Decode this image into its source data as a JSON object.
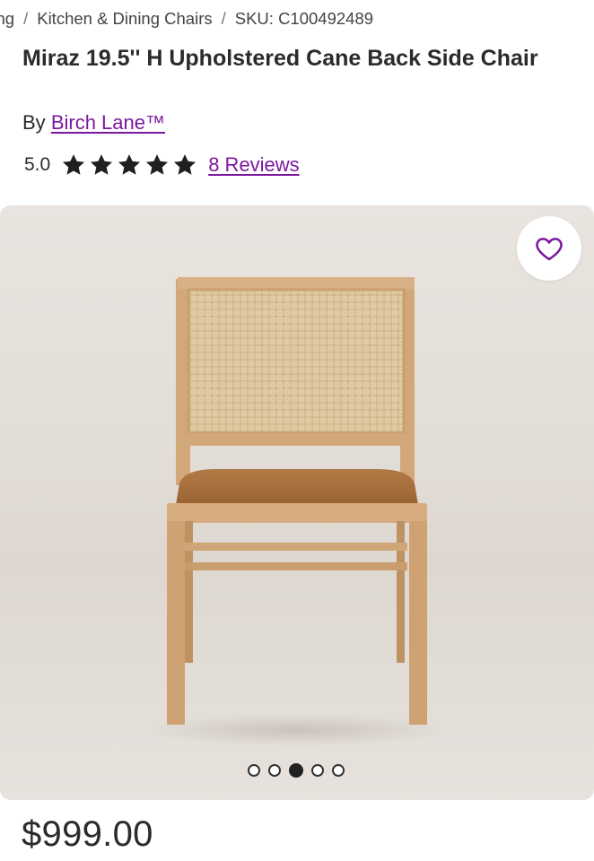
{
  "breadcrumb": {
    "items": [
      "Dining Tables & Seating",
      "Kitchen & Dining Chairs"
    ],
    "sku": "SKU: C100492489"
  },
  "product": {
    "title": "Miraz 19.5'' H Upholstered Cane Back Side Chair",
    "by_label": "By",
    "brand": "Birch Lane™",
    "rating": "5.0",
    "star_count": 5,
    "reviews_label": "8 Reviews",
    "price": "$999.00"
  },
  "gallery": {
    "image_count": 5,
    "active_index": 2,
    "favorite_icon": "heart-icon"
  },
  "colors": {
    "accent": "#7b189f",
    "text": "#2b2b2b"
  }
}
